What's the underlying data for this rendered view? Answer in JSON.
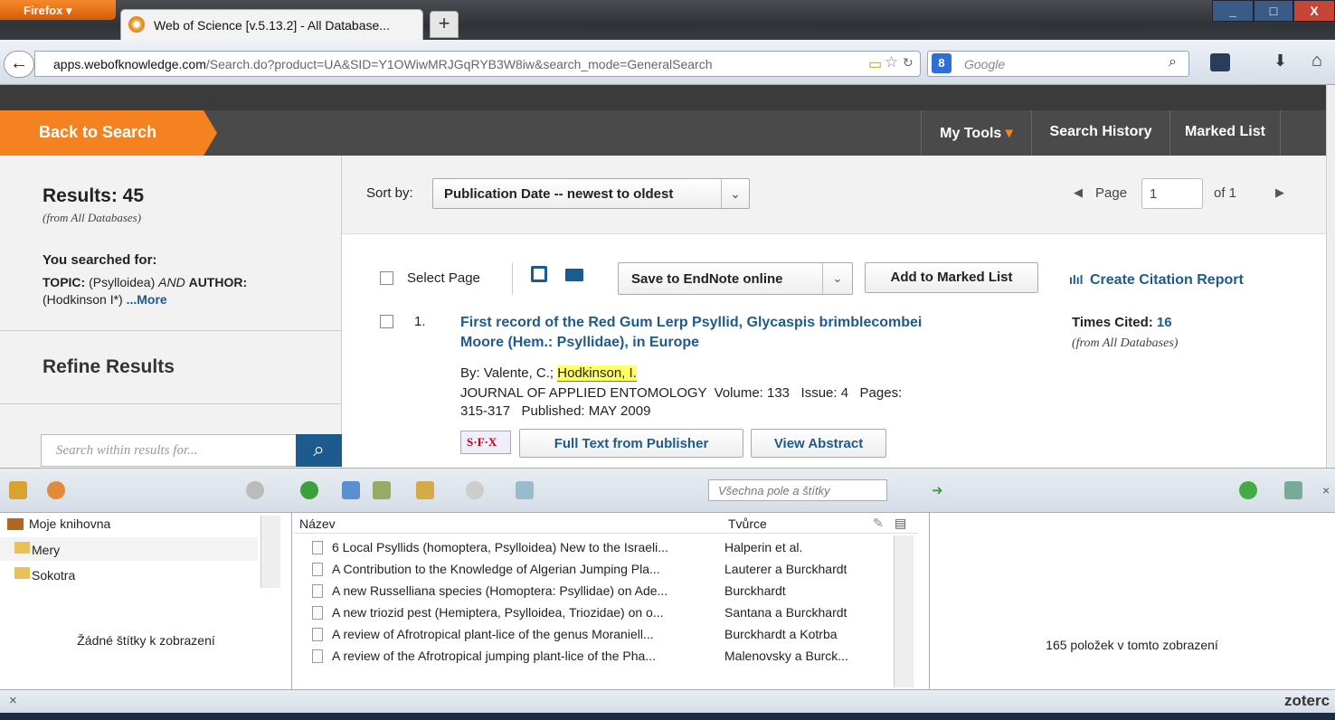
{
  "browser": {
    "menu_label": "Firefox",
    "tab_title": "Web of Science [v.5.13.2] - All Database...",
    "new_tab": "+",
    "url_domain": "apps.webofknowledge.com",
    "url_rest": "/Search.do?product=UA&SID=Y1OWiwMRJGqRYB3W8iw&search_mode=GeneralSearch",
    "search_engine": "8",
    "search_placeholder": "Google",
    "win_min": "_",
    "win_max": "□",
    "win_close": "X"
  },
  "wos": {
    "back_to_search": "Back to Search",
    "my_tools": "My Tools",
    "search_history": "Search History",
    "marked_list": "Marked List",
    "results_label": "Results: 45",
    "results_source": "(from All Databases)",
    "you_searched_for": "You searched for:",
    "topic_label": "TOPIC:",
    "topic_value": "(Psylloidea)",
    "and_word": "AND",
    "author_label": "AUTHOR:",
    "author_value": "(Hodkinson I*)",
    "more_link": "...More",
    "refine_results": "Refine Results",
    "search_within_placeholder": "Search within results for...",
    "sort_by_label": "Sort by:",
    "sort_value": "Publication Date -- newest to oldest",
    "page_label": "Page",
    "page_value": "1",
    "page_of": "of 1",
    "select_page": "Select Page",
    "save_endnote": "Save to EndNote online",
    "add_marked": "Add to Marked List",
    "citation_report": "Create Citation Report",
    "record": {
      "number": "1.",
      "title_line1": "First record of the Red Gum Lerp Psyllid, Glycaspis brimblecombei",
      "title_line2": "Moore (Hem.: Psyllidae), in Europe",
      "by_label": "By: Valente, C.;",
      "highlight_author": "Hodkinson, I.",
      "journal_line1": "JOURNAL OF APPLIED ENTOMOLOGY  Volume: 133   Issue: 4   Pages:",
      "journal_line2": "315-317   Published: MAY 2009",
      "sfx": "S·F·X",
      "full_text": "Full Text from Publisher",
      "view_abstract": "View Abstract",
      "times_cited_label": "Times Cited:",
      "times_cited_value": "16",
      "times_cited_source": "(from All Databases)"
    }
  },
  "zotero": {
    "search_placeholder": "Všechna pole a štítky",
    "library": "Moje knihovna",
    "collections": [
      "Mery",
      "Sokotra"
    ],
    "no_tags": "Žádné štítky k zobrazení",
    "col_title": "Název",
    "col_creator": "Tvůrce",
    "items": [
      {
        "title": "6 Local Psyllids (homoptera, Psylloidea) New to the Israeli...",
        "creator": "Halperin et al."
      },
      {
        "title": "A Contribution to the Knowledge of Algerian Jumping Pla...",
        "creator": "Lauterer a Burckhardt"
      },
      {
        "title": "A new Russelliana species (Homoptera: Psyllidae) on Ade...",
        "creator": "Burckhardt"
      },
      {
        "title": "A new triozid pest (Hemiptera, Psylloidea, Triozidae) on o...",
        "creator": "Santana a Burckhardt"
      },
      {
        "title": "A review of Afrotropical plant-lice of the genus Moraniell...",
        "creator": "Burckhardt a Kotrba"
      },
      {
        "title": "A review of the Afrotropical jumping plant-lice of the Pha...",
        "creator": "Malenovsky a Burck..."
      }
    ],
    "item_count": "165 položek v tomto zobrazení",
    "close": "×",
    "brand": "zoterc"
  },
  "colors": {
    "accent": "#f58220",
    "link": "#1d5a8e",
    "highlight": "#ffff66"
  }
}
